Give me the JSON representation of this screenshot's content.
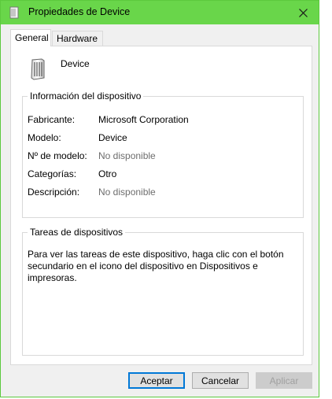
{
  "window": {
    "title": "Propiedades de Device"
  },
  "tabs": [
    {
      "label": "General",
      "active": true
    },
    {
      "label": "Hardware",
      "active": false
    }
  ],
  "device": {
    "name": "Device"
  },
  "info_group": {
    "title": "Información del dispositivo",
    "rows": [
      {
        "label": "Fabricante:",
        "value": "Microsoft Corporation"
      },
      {
        "label": "Modelo:",
        "value": "Device"
      },
      {
        "label": "Nº de modelo:",
        "value": "No disponible"
      },
      {
        "label": "Categorías:",
        "value": "Otro"
      },
      {
        "label": "Descripción:",
        "value": "No disponible"
      }
    ]
  },
  "tasks_group": {
    "title": "Tareas de dispositivos",
    "text": "Para ver las tareas de este dispositivo, haga clic con el botón secundario en el icono del dispositivo en Dispositivos e impresoras."
  },
  "buttons": {
    "accept": "Aceptar",
    "cancel": "Cancelar",
    "apply": "Aplicar"
  },
  "colors": {
    "titlebar": "#69d64a",
    "border": "#5cc93e",
    "focus": "#0078d7",
    "muted_text": "#6d6d6d"
  }
}
